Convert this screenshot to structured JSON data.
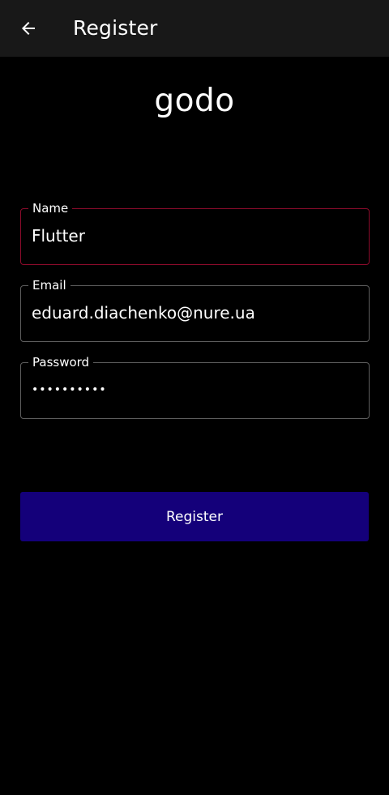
{
  "app_bar": {
    "title": "Register",
    "back_icon": "arrow-left-icon",
    "background": "#181818"
  },
  "logo": {
    "text": "godo"
  },
  "form": {
    "name": {
      "label": "Name",
      "value": "Flutter",
      "focused": true,
      "focus_color": "#8c0b2b"
    },
    "email": {
      "label": "Email",
      "value": "eduard.diachenko@nure.ua"
    },
    "password": {
      "label": "Password",
      "value": "••••••••••"
    }
  },
  "register_button": {
    "label": "Register",
    "color": "#14007a"
  }
}
